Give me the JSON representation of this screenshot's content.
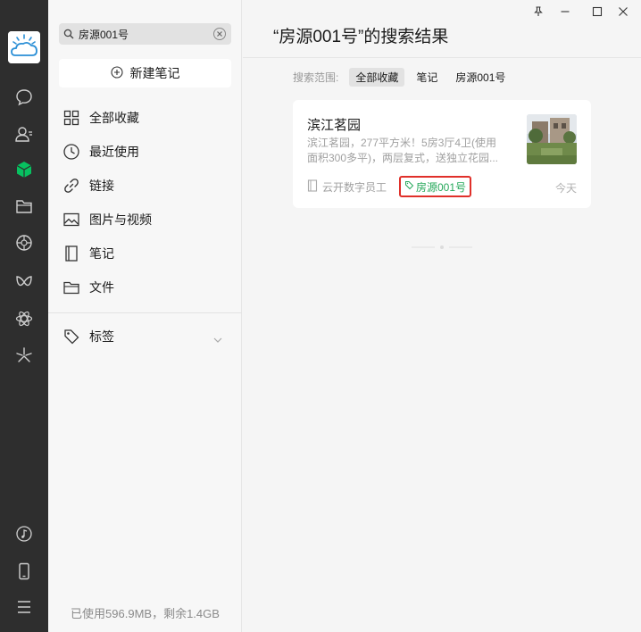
{
  "rail": {
    "icons": [
      "chat-icon",
      "contacts-icon",
      "favorites-icon",
      "files-folder-icon",
      "moments-icon",
      "channels-icon",
      "mini-programs-icon",
      "search-discover-icon",
      "music-icon",
      "phone-icon",
      "menu-icon"
    ]
  },
  "sidebar": {
    "search": {
      "value": "房源001号"
    },
    "new_note": "新建笔记",
    "items": [
      {
        "label": "全部收藏",
        "icon": "grid-icon"
      },
      {
        "label": "最近使用",
        "icon": "clock-icon"
      },
      {
        "label": "链接",
        "icon": "link-icon"
      },
      {
        "label": "图片与视频",
        "icon": "image-icon"
      },
      {
        "label": "笔记",
        "icon": "notebook-icon"
      },
      {
        "label": "文件",
        "icon": "folder-icon"
      }
    ],
    "tags": {
      "label": "标签",
      "icon": "tag-icon"
    },
    "storage": "已使用596.9MB，剩余1.4GB"
  },
  "main": {
    "title": "“房源001号”的搜索结果",
    "scope": {
      "label": "搜索范围:",
      "options": [
        "全部收藏",
        "笔记",
        "房源001号"
      ],
      "active_index": 0
    },
    "results": [
      {
        "title": "滨江茗园",
        "desc": "滨江茗园，277平方米！5房3厅4卫(使用面积300多平)，两层复式，送独立花园...",
        "source": "云开数字员工",
        "tag": "房源001号",
        "date": "今天"
      }
    ]
  },
  "colors": {
    "rail_bg": "#2e2e2e",
    "accent_green": "#07c160",
    "tag_text": "#25a85a",
    "highlight_border": "#e0302a"
  }
}
